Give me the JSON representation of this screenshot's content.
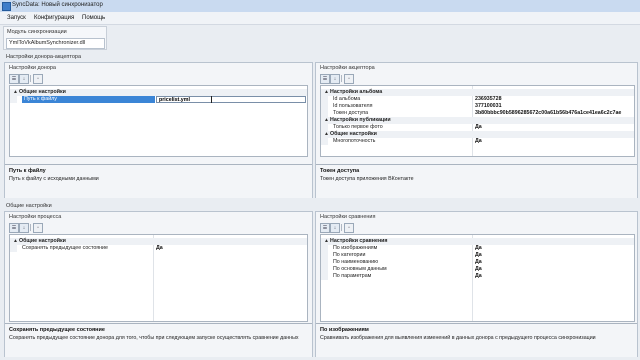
{
  "window": {
    "title": "SyncData: Новый синхронизатор"
  },
  "menu": [
    "Запуск",
    "Конфигурация",
    "Помощь"
  ],
  "module": {
    "label": "Модуль синхронизации",
    "value": "YmlToVkAlbumSynchronizer.dll"
  },
  "donor_acceptor_group": "Настройки донора-акцептора",
  "donor": {
    "title": "Настройки донора",
    "category": "Общие настройки",
    "selected_key": "Путь к файлу",
    "editing_value": "pricelist.yml",
    "desc_title": "Путь к файлу",
    "desc_text": "Путь к файлу с исходными данными"
  },
  "acceptor": {
    "title": "Настройки акцептора",
    "sections": [
      {
        "name": "Настройки альбома",
        "rows": [
          {
            "key": "Id альбома",
            "value": "236935728"
          },
          {
            "key": "Id пользователя",
            "value": "377100031"
          },
          {
            "key": "Токен доступа",
            "value": "3b80bbbc90b5896285672c00a61b56b476a1ce41ea6c2c7ae"
          }
        ]
      },
      {
        "name": "Настройки публикации",
        "rows": [
          {
            "key": "Только первое фото",
            "value": "Да"
          }
        ]
      },
      {
        "name": "Общие настройки",
        "rows": [
          {
            "key": "Многопоточность",
            "value": "Да"
          }
        ]
      }
    ],
    "desc_title": "Токен доступа",
    "desc_text": "Токен доступа приложения ВКонтакте"
  },
  "general_group": "Общие настройки",
  "process": {
    "title": "Настройки процесса",
    "category": "Общие настройки",
    "rows": [
      {
        "key": "Сохранять предыдущее состояние",
        "value": "Да"
      }
    ],
    "desc_title": "Сохранять предыдущее состояние",
    "desc_text": "Сохранять предыдущее состояние донора для того, чтобы при следующем запуске осуществлять сравнение данных"
  },
  "compare": {
    "title": "Настройки сравнения",
    "category": "Настройки сравнения",
    "rows": [
      {
        "key": "По изображениям",
        "value": "Да"
      },
      {
        "key": "По категории",
        "value": "Да"
      },
      {
        "key": "По наименованию",
        "value": "Да"
      },
      {
        "key": "По основным данным",
        "value": "Да"
      },
      {
        "key": "По параметрам",
        "value": "Да"
      }
    ],
    "desc_title": "По изображениям",
    "desc_text": "Сравнивать изображения для выявления изменений в данных донора с предыдущего процесса синхронизации"
  },
  "icons": {
    "categorized": "categorized-icon",
    "alphabetical": "sort-alpha-icon",
    "property_pages": "property-pages-icon"
  }
}
